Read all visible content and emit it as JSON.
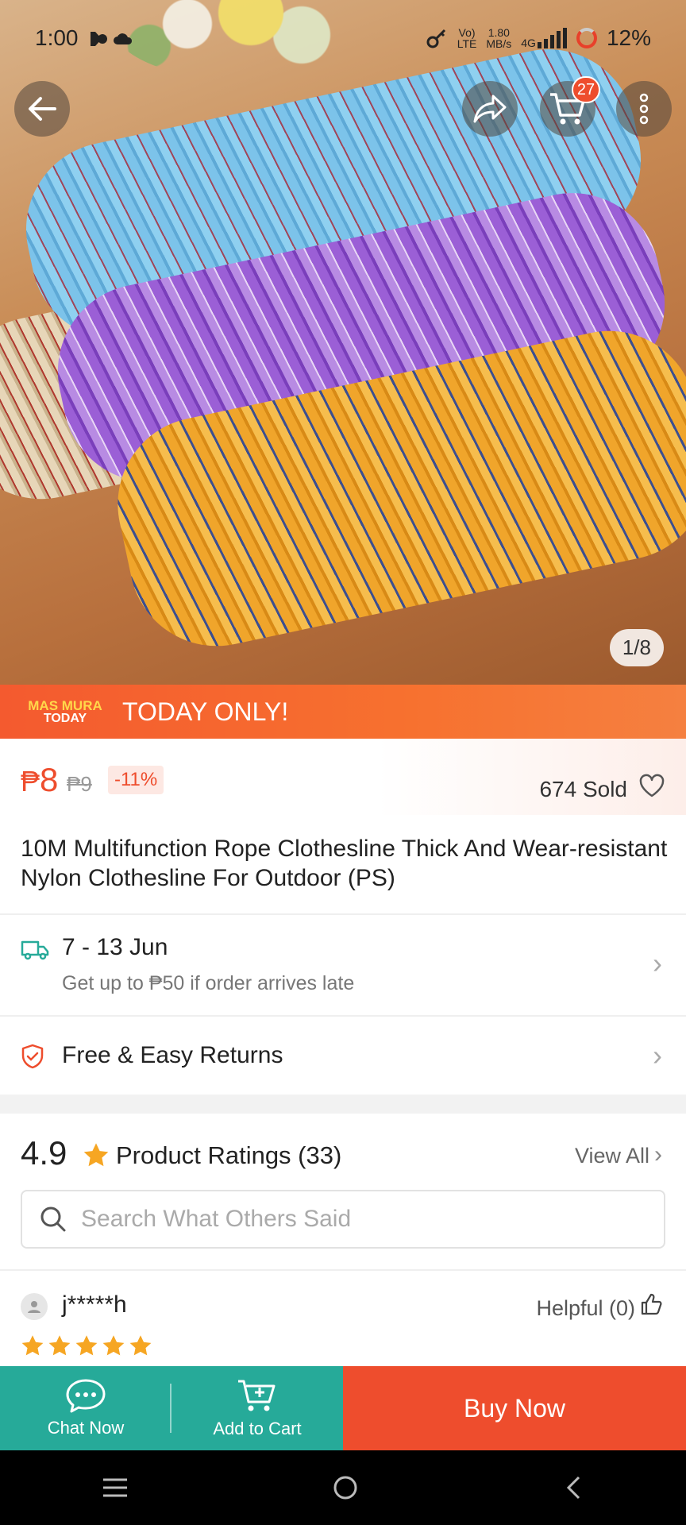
{
  "status_bar": {
    "time": "1:00",
    "network_1": "Vo)\nLTE",
    "speed": "1.80\nMB/s",
    "network_2": "4G",
    "battery": "12%"
  },
  "hero": {
    "cart_count": "27",
    "image_counter": "1/8"
  },
  "promo": {
    "logo_line1": "MAS MURA",
    "logo_line2": "TODAY",
    "text": "TODAY ONLY!"
  },
  "price": {
    "currency": "₱",
    "current": "8",
    "original": "₱9",
    "discount": "-11%",
    "sold": "674 Sold"
  },
  "product": {
    "title": "10M Multifunction Rope Clothesline Thick And Wear-resistant Nylon Clothesline For Outdoor (PS)"
  },
  "shipping": {
    "dates": "7 - 13 Jun",
    "guarantee": "Get up to ₱50 if order arrives late"
  },
  "returns": {
    "label": "Free & Easy Returns"
  },
  "ratings": {
    "score": "4.9",
    "label": "Product Ratings (33)",
    "view_all": "View All",
    "search_placeholder": "Search What Others Said"
  },
  "review": {
    "user": "j*****h",
    "helpful": "Helpful (0)",
    "stars": 5
  },
  "actions": {
    "chat_label": "Chat Now",
    "cart_label": "Add to Cart",
    "buy_label": "Buy Now"
  },
  "colors": {
    "brand": "#ee4d2d",
    "teal": "#26aa99",
    "star": "#f6a623"
  }
}
